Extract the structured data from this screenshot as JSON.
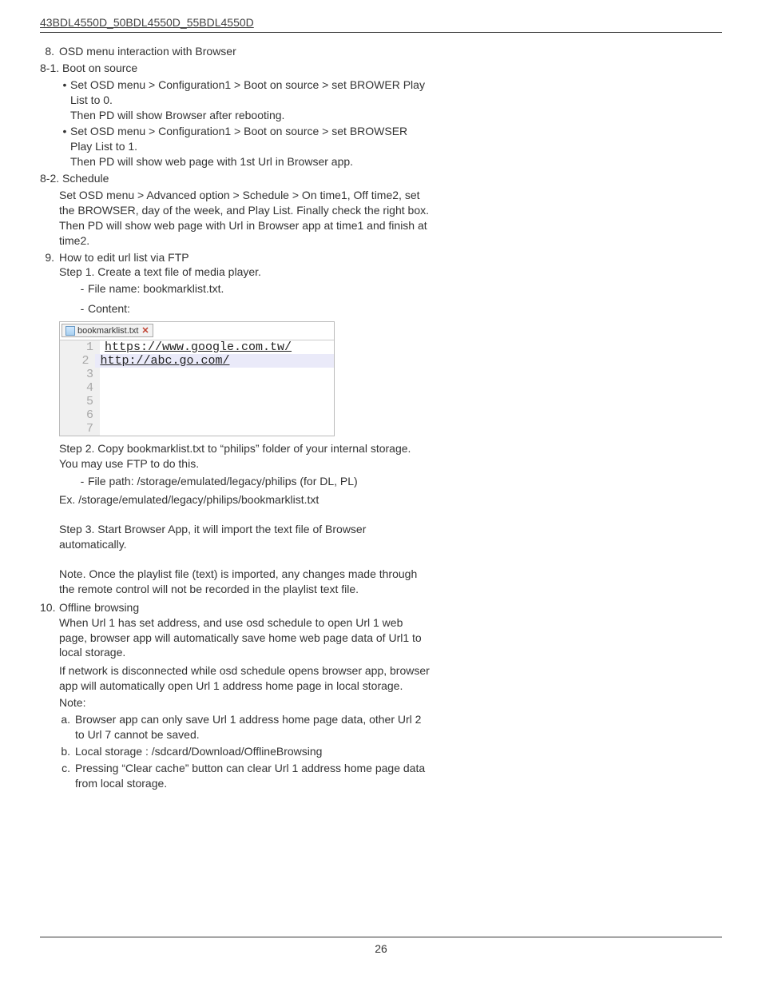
{
  "header": "43BDL4550D_50BDL4550D_55BDL4550D",
  "items": {
    "i8": "OSD menu interaction with Browser",
    "i8_1": "8-1. Boot on source",
    "b1a": "Set OSD menu > Configuration1 > Boot on source > set BROWER Play List to 0.",
    "b1b": "Then PD will show Browser after rebooting.",
    "b2a": "Set OSD menu > Configuration1 > Boot on source > set BROWSER Play List to 1.",
    "b2b": "Then PD will show web page with 1st Url in Browser app.",
    "i8_2": "8-2. Schedule",
    "sch": "Set OSD menu > Advanced option > Schedule > On time1, Off time2, set the BROWSER, day of the week, and Play List. Finally check the right box. Then PD will show web page with Url in Browser app at time1 and finish at time2.",
    "i9": "How to edit url list via FTP",
    "i9s1": "Step 1. Create a text file of media player.",
    "d1": "File name: bookmarklist.txt.",
    "d2": "Content:",
    "i9s2": "Step 2. Copy bookmarklist.txt to “philips” folder of your internal storage. You may use FTP to do this.",
    "d3": "File path: /storage/emulated/legacy/philips (for DL, PL)",
    "ex": "Ex. /storage/emulated/legacy/philips/bookmarklist.txt",
    "i9s3": "Step 3. Start Browser App, it will import the text file of Browser automatically.",
    "note1": "Note. Once the playlist file (text) is imported, any changes made through the remote control will not be recorded in the playlist text file.",
    "i10": "Offline browsing",
    "i10a": "When Url 1 has set address, and use osd schedule to open Url 1 web page, browser app will automatically save home web page data of Url1 to local storage.",
    "i10b": "If network is disconnected while osd schedule opens browser app, browser app will automatically open Url 1 address home page in local storage.",
    "noteLbl": "Note:",
    "na": "Browser app can only save Url 1 address home page data, other Url 2 to Url 7 cannot be saved.",
    "nb": "Local storage : /sdcard/Download/OfflineBrowsing",
    "nc": "Pressing “Clear cache” button can clear Url 1 address home page data from local storage."
  },
  "editor": {
    "tabTitle": "bookmarklist.txt",
    "lines": [
      {
        "n": "1",
        "t": "https://www.google.com.tw/",
        "link": true
      },
      {
        "n": "2",
        "t": "http://abc.go.com/",
        "link": true,
        "sel": true
      },
      {
        "n": "3",
        "t": ""
      },
      {
        "n": "4",
        "t": ""
      },
      {
        "n": "5",
        "t": ""
      },
      {
        "n": "6",
        "t": ""
      },
      {
        "n": "7",
        "t": ""
      }
    ]
  },
  "pageNumber": "26"
}
